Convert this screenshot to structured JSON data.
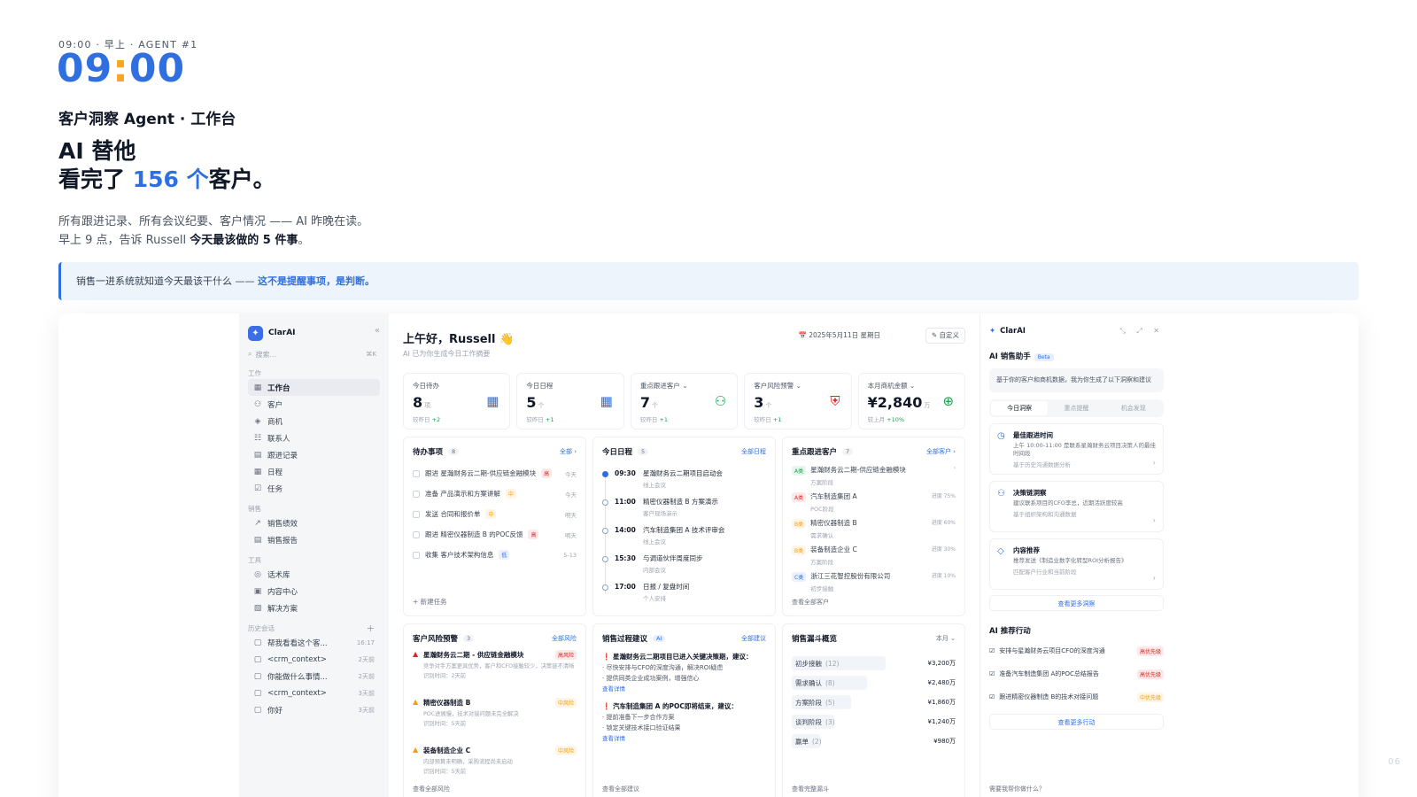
{
  "header": {
    "eyebrow": "09:00 · 早上 · AGENT #1",
    "clock_h": "09",
    "clock_sep": ":",
    "clock_m": "00",
    "subtitle": "客户洞察 Agent · 工作台",
    "headline_line1": "AI 替他",
    "headline_pre": "看完了 ",
    "headline_num": "156 个",
    "headline_post": "客户。",
    "desc_line1": "所有跟进记录、所有会议纪要、客户情况 —— AI 昨晚在读。",
    "desc_line2_pre": "早上 9 点，告诉 Russell ",
    "desc_line2_bold": "今天最该做的 5 件事",
    "desc_line2_post": "。",
    "callout_pre": "销售一进系统就知道今天最该干什么 —— ",
    "callout_hl": "这不是提醒事项，是判断。",
    "page_number": "06"
  },
  "app": {
    "brand": "ClarAI",
    "collapse_icon": "«",
    "search_placeholder": "搜索...",
    "search_kbd": "⌘K",
    "groups": {
      "work": "工作",
      "sales": "销售",
      "tools": "工具",
      "history": "历史会话"
    },
    "work_items": [
      {
        "icon": "▦",
        "label": "工作台"
      },
      {
        "icon": "⚇",
        "label": "客户"
      },
      {
        "icon": "◈",
        "label": "商机"
      },
      {
        "icon": "☷",
        "label": "联系人"
      },
      {
        "icon": "▤",
        "label": "跟进记录"
      },
      {
        "icon": "▦",
        "label": "日程"
      },
      {
        "icon": "☑",
        "label": "任务"
      }
    ],
    "sales_items": [
      {
        "icon": "↗",
        "label": "销售绩效"
      },
      {
        "icon": "▤",
        "label": "销售报告"
      }
    ],
    "tool_items": [
      {
        "icon": "◎",
        "label": "话术库"
      },
      {
        "icon": "▣",
        "label": "内容中心"
      },
      {
        "icon": "▧",
        "label": "解决方案"
      }
    ],
    "history_items": [
      {
        "label": "帮我看看这个客...",
        "time": "16:17"
      },
      {
        "label": "<crm_context>",
        "time": "2天前"
      },
      {
        "label": "你能做什么事情...",
        "time": "2天前"
      },
      {
        "label": "<crm_context>",
        "time": "3天前"
      },
      {
        "label": "你好",
        "time": "3天前"
      }
    ],
    "greeting": "上午好，Russell 👋",
    "greeting_sub": "AI 已为你生成今日工作摘要",
    "date": "📅 2025年5月11日 星期日",
    "customize": "✎ 自定义",
    "stats": [
      {
        "label": "今日待办",
        "value": "8",
        "unit": "项",
        "cmp": "较昨日 ",
        "delta": "+2",
        "icon": "▦",
        "color": "#2f6fe0"
      },
      {
        "label": "今日日程",
        "value": "5",
        "unit": "个",
        "cmp": "较昨日 ",
        "delta": "+1",
        "icon": "▦",
        "color": "#2f6fe0"
      },
      {
        "label": "重点跟进客户 ⌄",
        "value": "7",
        "unit": "个",
        "cmp": "较昨日 ",
        "delta": "+1",
        "icon": "⚇",
        "color": "#16a34a"
      },
      {
        "label": "客户风险预警 ⌄",
        "value": "3",
        "unit": "个",
        "cmp": "较昨日 ",
        "delta": "+1",
        "icon": "⛨",
        "color": "#dc2626"
      },
      {
        "label": "本月商机金额 ⌄",
        "value": "¥2,840",
        "unit": "万",
        "cmp": "较上月 ",
        "delta": "+10%",
        "icon": "⊕",
        "color": "#16a34a"
      }
    ],
    "todo": {
      "title": "待办事项",
      "count": "8",
      "more": "全部 ›",
      "items": [
        {
          "text": "跟进  星瀚财务云二期-供应链金融模块",
          "tag": "高",
          "tag_color": "#dc2626",
          "due": "今天"
        },
        {
          "text": "准备  产品演示和方案讲解",
          "tag": "中",
          "tag_color": "#f59e0b",
          "due": "今天"
        },
        {
          "text": "发送  合同和报价单",
          "tag": "中",
          "tag_color": "#f59e0b",
          "due": "明天"
        },
        {
          "text": "跟进  精密仪器制造 B 的POC反馈",
          "tag": "高",
          "tag_color": "#dc2626",
          "due": "明天"
        },
        {
          "text": "收集  客户技术架构信息",
          "tag": "低",
          "tag_color": "#2f6fe0",
          "due": "5-13"
        }
      ],
      "add": "+ 新建任务"
    },
    "schedule": {
      "title": "今日日程",
      "count": "5",
      "more": "全部日程",
      "items": [
        {
          "time": "09:30",
          "text": "星瀚财务云二期项目启动会",
          "sub": "线上会议",
          "active": true
        },
        {
          "time": "11:00",
          "text": "精密仪器制造 B 方案演示",
          "sub": "客户现场演示",
          "active": false
        },
        {
          "time": "14:00",
          "text": "汽车制造集团 A 技术评审会",
          "sub": "线上会议",
          "active": false
        },
        {
          "time": "15:30",
          "text": "与调道伙伴周度同步",
          "sub": "内部会议",
          "active": false
        },
        {
          "time": "17:00",
          "text": "日报 / 复盘时间",
          "sub": "个人安排",
          "active": false
        }
      ]
    },
    "key_customers": {
      "title": "重点跟进客户",
      "count": "7",
      "more": "全部客户 ›",
      "items": [
        {
          "level": "A类",
          "level_color": "#16a34a",
          "name": "星瀚财务云二期-供应链金融模块",
          "stage": "方案阶段",
          "pct": "›"
        },
        {
          "level": "A类",
          "level_color": "#dc2626",
          "name": "汽车制造集团 A",
          "stage": "POC阶段",
          "pct": "进度 75%"
        },
        {
          "level": "B类",
          "level_color": "#f59e0b",
          "name": "精密仪器制造 B",
          "stage": "需求确认",
          "pct": "进度 60%"
        },
        {
          "level": "B类",
          "level_color": "#f59e0b",
          "name": "装备制造企业 C",
          "stage": "方案阶段",
          "pct": "进度 30%"
        },
        {
          "level": "C类",
          "level_color": "#2f6fe0",
          "name": "浙江三花智控股份有限公司",
          "stage": "初步接触",
          "pct": "进度 10%"
        }
      ],
      "foot": "查看全部客户"
    },
    "risk": {
      "title": "客户风险预警",
      "count": "3",
      "more": "全部风险",
      "items": [
        {
          "name": "星瀚财务云二期 - 供应链金融模块",
          "level": "高风险",
          "color": "#dc2626",
          "d1": "竞争对手方案更具优势，客户和CFO接触较少，决策链不清晰",
          "d2": "识别时间：2天前"
        },
        {
          "name": "精密仪器制造 B",
          "level": "中风险",
          "color": "#f59e0b",
          "d1": "POC进展慢，技术对接问题未完全解决",
          "d2": "识别时间：5天前"
        },
        {
          "name": "装备制造企业 C",
          "level": "中风险",
          "color": "#f59e0b",
          "d1": "内部预算未明确，采购流程尚未启动",
          "d2": "识别时间：5天前"
        }
      ],
      "foot": "查看全部风险"
    },
    "suggest": {
      "title": "销售过程建议",
      "ai": "AI",
      "more": "全部建议",
      "items": [
        {
          "title": "星瀚财务云二期项目已进入关键决策期，建议：",
          "l1": "· 尽快安排与CFO的深度沟通，解决ROI疑虑",
          "l2": "· 提供同类企业成功案例，增强信心",
          "link": "查看详情"
        },
        {
          "title": "汽车制造集团 A 的POC即将结束，建议：",
          "l1": "· 提前准备下一步合作方案",
          "l2": "· 锁定关键技术接口验证结果",
          "link": "查看详情"
        }
      ],
      "foot": "查看全部建议"
    },
    "funnel": {
      "title": "销售漏斗概览",
      "period": "本月 ⌄",
      "rows": [
        {
          "stage": "初步接触",
          "count": "(12)",
          "amount": "¥3,200万",
          "share": 0.92
        },
        {
          "stage": "需求确认",
          "count": "(8)",
          "amount": "¥2,480万",
          "share": 0.74
        },
        {
          "stage": "方案阶段",
          "count": "(5)",
          "amount": "¥1,860万",
          "share": 0.58
        },
        {
          "stage": "谈判阶段",
          "count": "(3)",
          "amount": "¥1,240万",
          "share": 0.42
        },
        {
          "stage": "赢单",
          "count": "(2)",
          "amount": "¥980万",
          "share": 0.28
        }
      ],
      "foot": "查看完整漏斗"
    },
    "assistant": {
      "brand": "ClarAI",
      "controls": "⤡ ⤢ ✕",
      "heading": "AI 销售助手",
      "beta": "Beta",
      "intro": "基于你的客户和商机数据，我为你生成了以下洞察和建议",
      "tabs": [
        "今日洞察",
        "重点提醒",
        "机会发现"
      ],
      "insights": [
        {
          "icon": "◷",
          "title": "最佳跟进时间",
          "desc": "上午 10:00-11:00 是联系星瀚财务云项目决策人的最佳时间段",
          "basis": "基于历史沟通数据分析"
        },
        {
          "icon": "⚇",
          "title": "决策链洞察",
          "desc": "建议联系项目的CFO李总，近期活跃度较高",
          "basis": "基于组织架构和沟通数据"
        },
        {
          "icon": "◇",
          "title": "内容推荐",
          "desc": "推荐发送《制造业数字化转型ROI分析报告》",
          "basis": "匹配客户行业和当前阶段"
        }
      ],
      "more_insights": "查看更多洞察",
      "actions_title": "AI 推荐行动",
      "actions": [
        {
          "text": "安排与星瀚财务云项目CFO的深度沟通",
          "pr": "高优先级",
          "color": "#dc2626"
        },
        {
          "text": "准备汽车制造集团 A的POC总结报告",
          "pr": "高优先级",
          "color": "#dc2626"
        },
        {
          "text": "跟进精密仪器制造 B的技术对接问题",
          "pr": "中优先级",
          "color": "#f59e0b"
        }
      ],
      "more_actions": "查看更多行动",
      "ask": "需要我帮你做什么？"
    }
  }
}
